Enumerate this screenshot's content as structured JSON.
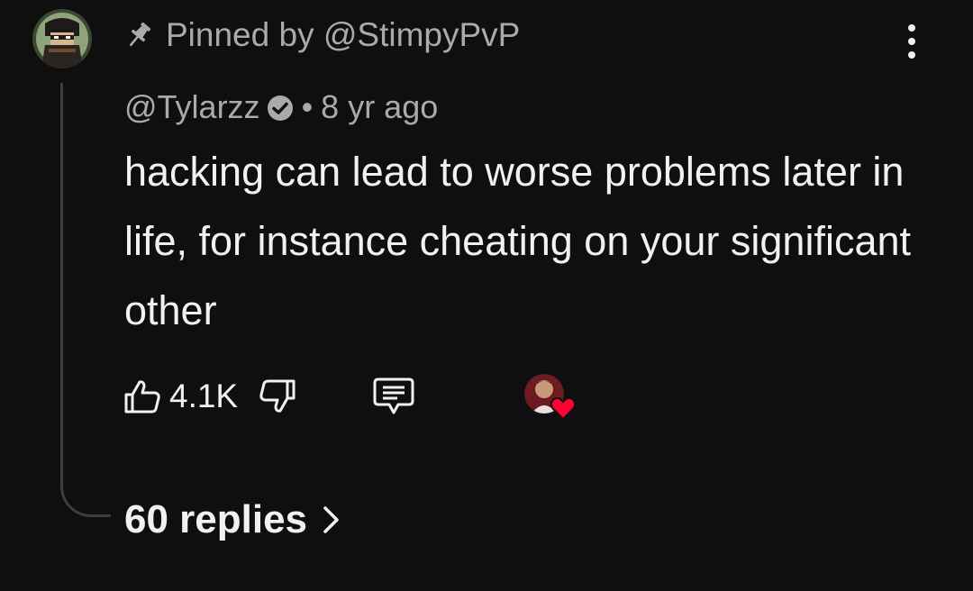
{
  "comment": {
    "pinned_label": "Pinned by @StimpyPvP",
    "author_handle": "@Tylarzz",
    "separator": "•",
    "timestamp": "8 yr ago",
    "text": "hacking can lead to worse problems later in life, for instance cheating on your significant other",
    "likes": "4.1K",
    "replies_label": "60 replies"
  },
  "icons": {
    "pin": "pin-icon",
    "verified": "verified-checkmark-icon",
    "menu": "more-vert-icon",
    "like": "thumbs-up-icon",
    "dislike": "thumbs-down-icon",
    "reply": "reply-comment-icon",
    "creator_heart": "heart-icon",
    "replies_chevron": "chevron-right-icon"
  },
  "colors": {
    "background": "#0f0f0f",
    "primary_text": "#f1f1f1",
    "secondary_text": "#aaaaaa",
    "thread_line": "#3d3d3d",
    "heart": "#ff0033"
  }
}
